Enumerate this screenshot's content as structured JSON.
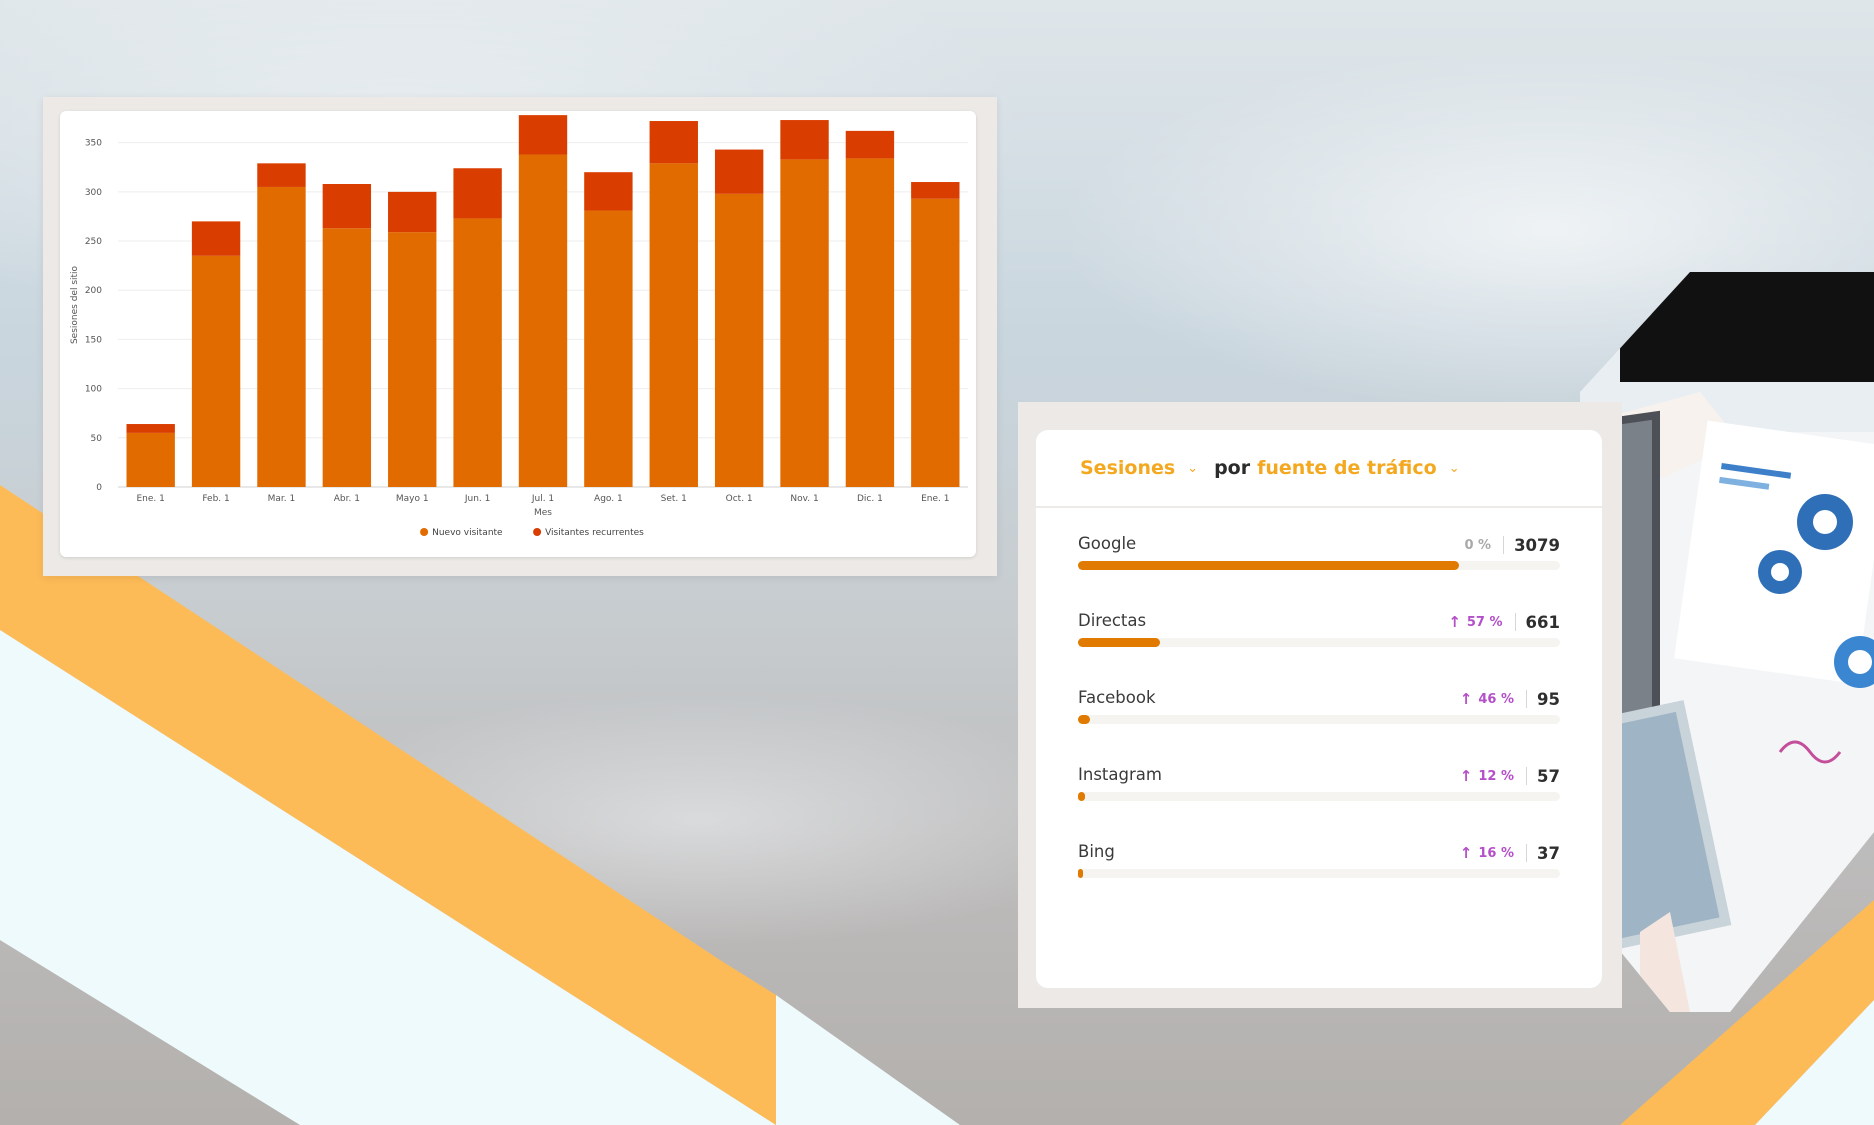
{
  "colors": {
    "new_visitor": "#e26b00",
    "returning_visitor": "#d93d00",
    "accent_yellow": "#f4a81f",
    "positive_change": "#b44fc9",
    "bar_fill": "#e07a00"
  },
  "chart_data": {
    "type": "bar",
    "stacked": true,
    "title": "",
    "xlabel": "Mes",
    "ylabel": "Sesiones del sitio",
    "ylim": [
      0,
      370
    ],
    "yticks": [
      0,
      50,
      100,
      150,
      200,
      250,
      300,
      350
    ],
    "grid": true,
    "legend_position": "bottom",
    "categories": [
      "Ene. 1",
      "Feb. 1",
      "Mar. 1",
      "Abr. 1",
      "Mayo 1",
      "Jun. 1",
      "Jul. 1",
      "Ago. 1",
      "Set. 1",
      "Oct. 1",
      "Nov. 1",
      "Dic. 1",
      "Ene. 1"
    ],
    "series": [
      {
        "name": "Nuevo visitante",
        "values": [
          55,
          235,
          305,
          263,
          259,
          273,
          338,
          281,
          329,
          298,
          333,
          334,
          293
        ]
      },
      {
        "name": "Visitantes recurrentes",
        "values": [
          9,
          35,
          24,
          45,
          41,
          51,
          40,
          39,
          43,
          45,
          40,
          28,
          17
        ]
      }
    ]
  },
  "traffic": {
    "metric_label": "Sesiones",
    "dimension_connector": "por",
    "dimension_label": "fuente de tráfico",
    "rows": [
      {
        "name": "Google",
        "change": "0 %",
        "trend": "flat",
        "value": "3079",
        "share": 0.79
      },
      {
        "name": "Directas",
        "change": "57 %",
        "trend": "up",
        "value": "661",
        "share": 0.17
      },
      {
        "name": "Facebook",
        "change": "46 %",
        "trend": "up",
        "value": "95",
        "share": 0.025
      },
      {
        "name": "Instagram",
        "change": "12 %",
        "trend": "up",
        "value": "57",
        "share": 0.015
      },
      {
        "name": "Bing",
        "change": "16 %",
        "trend": "up",
        "value": "37",
        "share": 0.01
      }
    ]
  }
}
